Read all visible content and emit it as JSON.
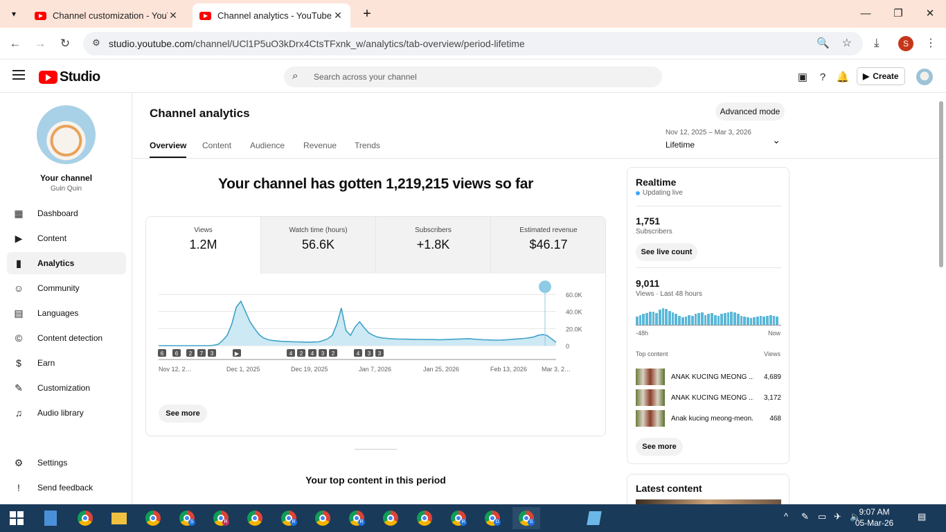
{
  "browser": {
    "tabs": [
      {
        "title": "Channel customization - YouTube Studio",
        "active": false
      },
      {
        "title": "Channel analytics - YouTube Studio",
        "active": true
      }
    ],
    "url_host": "studio.youtube.com",
    "url_path": "/channel/UCl1P5uO3kDrx4CtsTFxnk_w/analytics/tab-overview/period-lifetime",
    "profile_initial": "S"
  },
  "header": {
    "logo": "Studio",
    "search_placeholder": "Search across your channel",
    "create": "Create"
  },
  "sidebar": {
    "channel_title": "Your channel",
    "channel_name": "Guin Quin",
    "items": [
      {
        "label": "Dashboard",
        "icon": "dashboard-icon"
      },
      {
        "label": "Content",
        "icon": "content-icon"
      },
      {
        "label": "Analytics",
        "icon": "analytics-icon",
        "selected": true
      },
      {
        "label": "Community",
        "icon": "community-icon"
      },
      {
        "label": "Languages",
        "icon": "languages-icon"
      },
      {
        "label": "Content detection",
        "icon": "copyright-icon"
      },
      {
        "label": "Earn",
        "icon": "dollar-icon"
      },
      {
        "label": "Customization",
        "icon": "magic-wand-icon"
      },
      {
        "label": "Audio library",
        "icon": "audio-library-icon"
      }
    ],
    "settings": "Settings",
    "feedback": "Send feedback"
  },
  "page": {
    "title": "Channel analytics",
    "advanced": "Advanced mode",
    "tabs": [
      "Overview",
      "Content",
      "Audience",
      "Revenue",
      "Trends"
    ],
    "active_tab": "Overview",
    "period_range": "Nov 12, 2025 – Mar 3, 2026",
    "period_label": "Lifetime",
    "headline": "Your channel has gotten 1,219,215 views so far",
    "metrics": [
      {
        "label": "Views",
        "value": "1.2M"
      },
      {
        "label": "Watch time (hours)",
        "value": "56.6K"
      },
      {
        "label": "Subscribers",
        "value": "+1.8K"
      },
      {
        "label": "Estimated revenue",
        "value": "$46.17"
      }
    ],
    "see_more": "See more",
    "top_content_title": "Your top content in this period"
  },
  "chart_data": {
    "type": "area",
    "series": [
      {
        "values": [
          0,
          0,
          0,
          0,
          0,
          0,
          0,
          0,
          0,
          0,
          0,
          0,
          500,
          1500,
          6000,
          12000,
          25000,
          45000,
          52000,
          40000,
          28000,
          20000,
          13000,
          9000,
          7000,
          6000,
          5500,
          5000,
          4800,
          4600,
          4500,
          4300,
          4200,
          4000,
          4300,
          4500,
          6000,
          8000,
          12000,
          25000,
          44000,
          18000,
          12000,
          22000,
          28000,
          21000,
          15000,
          12000,
          10000,
          9000,
          8500,
          8000,
          7800,
          7700,
          7600,
          7500,
          7400,
          7300,
          7200,
          7100,
          7100,
          7000,
          7000,
          7200,
          7400,
          7600,
          7800,
          8000,
          8200,
          7600,
          7300,
          7000,
          6800,
          6600,
          6500,
          6600,
          6800,
          7200,
          7600,
          8000,
          8500,
          9200,
          10000,
          12000,
          13000,
          12000,
          8000,
          4000
        ]
      }
    ],
    "x_labels": [
      "Nov 12, 2…",
      "Dec 1, 2025",
      "Dec 19, 2025",
      "Jan 7, 2026",
      "Jan 25, 2026",
      "Feb 13, 2026",
      "Mar 3, 2…"
    ],
    "y_ticks": [
      "60.0K",
      "40.0K",
      "20.0K",
      "0"
    ],
    "ylim": [
      0,
      60000
    ],
    "markers": [
      "6",
      "6",
      "2",
      "7",
      "3",
      "▶",
      "4",
      "2",
      "4",
      "3",
      "2",
      "4",
      "3",
      "3"
    ],
    "grid": true
  },
  "realtime": {
    "title": "Realtime",
    "status": "Updating live",
    "subs": "1,751",
    "subs_label": "Subscribers",
    "see_live": "See live count",
    "views": "9,011",
    "views_label": "Views · Last 48 hours",
    "from": "-48h",
    "to": "Now",
    "bars": [
      10,
      12,
      13,
      14,
      16,
      16,
      14,
      18,
      20,
      19,
      17,
      15,
      13,
      11,
      9,
      10,
      12,
      11,
      13,
      14,
      15,
      12,
      13,
      14,
      12,
      11,
      13,
      14,
      15,
      16,
      15,
      13,
      11,
      10,
      9,
      8,
      9,
      10,
      11,
      10,
      11,
      12,
      11,
      10
    ],
    "top_content_label": "Top content",
    "views_col": "Views",
    "rows": [
      {
        "title": "ANAK KUCING MEONG ...",
        "views": "4,689"
      },
      {
        "title": "ANAK KUCING MEONG ...",
        "views": "3,172"
      },
      {
        "title": "Anak kucing meong-meon...",
        "views": "468"
      }
    ],
    "see_more": "See more"
  },
  "latest": {
    "title": "Latest content"
  },
  "taskbar": {
    "time": "9:07 AM",
    "date": "05-Mar-26",
    "badges": [
      "",
      "S",
      "R",
      "",
      "R",
      "",
      "R",
      "",
      "",
      "R",
      "D",
      "S"
    ]
  }
}
